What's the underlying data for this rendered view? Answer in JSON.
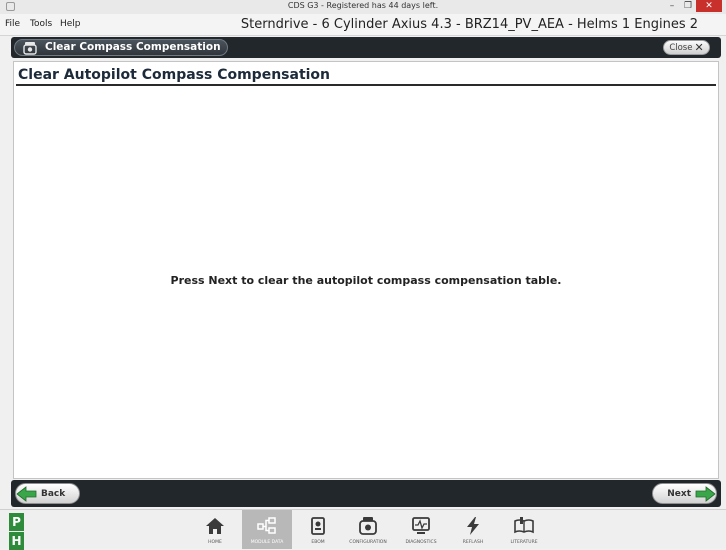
{
  "window": {
    "title": "CDS G3 - Registered has 44 days left.",
    "controls": {
      "minimize": "–",
      "maximize": "❐",
      "close": "✕"
    }
  },
  "menu": {
    "items": [
      "File",
      "Tools",
      "Help"
    ],
    "document_title": "Sterndrive - 6 Cylinder Axius 4.3 - BRZ14_PV_AEA - Helms 1 Engines 2"
  },
  "header": {
    "title": "Clear Compass Compensation",
    "icon": "compass-module-icon",
    "close_label": "Close",
    "close_glyph": "✕"
  },
  "panel": {
    "title": "Clear Autopilot Compass Compensation",
    "instruction": "Press Next to clear the autopilot compass compensation table."
  },
  "footer": {
    "back_label": "Back",
    "next_label": "Next",
    "back_icon": "left-arrow-icon",
    "next_icon": "right-arrow-icon"
  },
  "taskbar": {
    "mode_badges": [
      "P",
      "H"
    ],
    "items": [
      {
        "label": "HOME",
        "icon": "home-icon",
        "active": false
      },
      {
        "label": "MODULE DATA",
        "icon": "module-data-icon",
        "active": true
      },
      {
        "label": "EBOM",
        "icon": "ebom-icon",
        "active": false
      },
      {
        "label": "CONFIGURATION",
        "icon": "configuration-icon",
        "active": false
      },
      {
        "label": "DIAGNOSTICS",
        "icon": "diagnostics-icon",
        "active": false
      },
      {
        "label": "REFLASH",
        "icon": "reflash-icon",
        "active": false
      },
      {
        "label": "LITERATURE",
        "icon": "literature-icon",
        "active": false
      }
    ]
  },
  "colors": {
    "dark_bar": "#22272c",
    "accent_green": "#2e8b3c",
    "close_red": "#c8302b",
    "active_tab": "#b8b8b8"
  }
}
